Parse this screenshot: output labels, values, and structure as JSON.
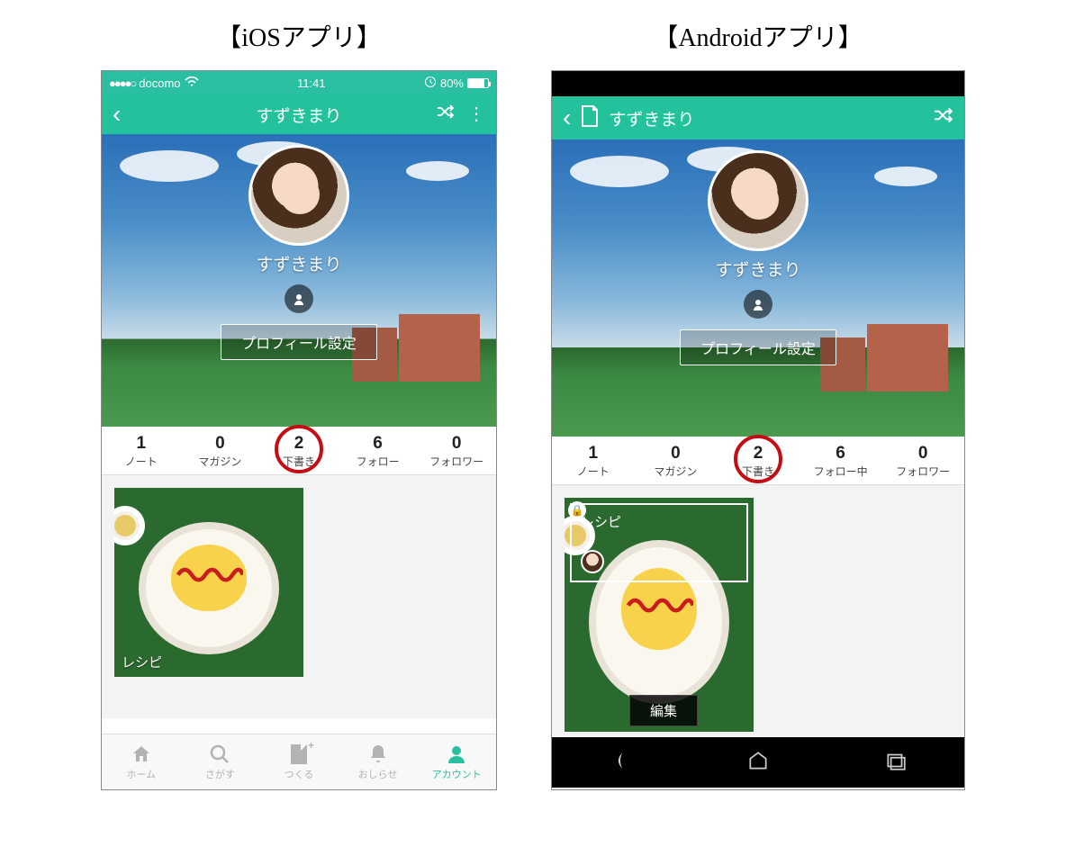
{
  "titles": {
    "ios": "【iOSアプリ】",
    "android": "【Androidアプリ】"
  },
  "ios": {
    "status": {
      "carrier": "docomo",
      "time": "11:41",
      "battery": "80%"
    },
    "nav": {
      "title": "すずきまり"
    },
    "profile": {
      "name": "すずきまり",
      "settings": "プロフィール設定"
    },
    "stats": [
      {
        "num": "1",
        "label": "ノート"
      },
      {
        "num": "0",
        "label": "マガジン"
      },
      {
        "num": "2",
        "label": "下書き",
        "circled": true
      },
      {
        "num": "6",
        "label": "フォロー"
      },
      {
        "num": "0",
        "label": "フォロワー"
      }
    ],
    "card": {
      "label": "レシピ"
    },
    "tabs": [
      {
        "label": "ホーム",
        "icon": "home",
        "active": false
      },
      {
        "label": "さがす",
        "icon": "search",
        "active": false
      },
      {
        "label": "つくる",
        "icon": "create",
        "active": false
      },
      {
        "label": "おしらせ",
        "icon": "bell",
        "active": false
      },
      {
        "label": "アカウント",
        "icon": "account",
        "active": true
      }
    ]
  },
  "android": {
    "nav": {
      "title": "すずきまり"
    },
    "profile": {
      "name": "すずきまり",
      "settings": "プロフィール設定"
    },
    "stats": [
      {
        "num": "1",
        "label": "ノート"
      },
      {
        "num": "0",
        "label": "マガジン"
      },
      {
        "num": "2",
        "label": "下書き",
        "circled": true
      },
      {
        "num": "6",
        "label": "フォロー中"
      },
      {
        "num": "0",
        "label": "フォロワー"
      }
    ],
    "card": {
      "label": "レシピ",
      "edit": "編集"
    }
  }
}
